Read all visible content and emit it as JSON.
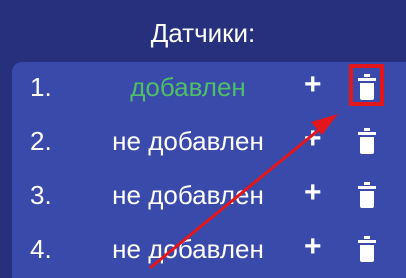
{
  "header": {
    "title": "Датчики:"
  },
  "sensors": [
    {
      "number": "1.",
      "status": "добавлен",
      "add_label": "+",
      "delete_icon": "trash-icon"
    },
    {
      "number": "2.",
      "status": "не добавлен",
      "add_label": "+",
      "delete_icon": "trash-icon"
    },
    {
      "number": "3.",
      "status": "не добавлен",
      "add_label": "+",
      "delete_icon": "trash-icon"
    },
    {
      "number": "4.",
      "status": "не добавлен",
      "add_label": "+",
      "delete_icon": "trash-icon"
    }
  ],
  "colors": {
    "background": "#27307c",
    "panel": "#3a4aab",
    "added_status": "#4fbf67",
    "annotation": "#e3161c"
  }
}
